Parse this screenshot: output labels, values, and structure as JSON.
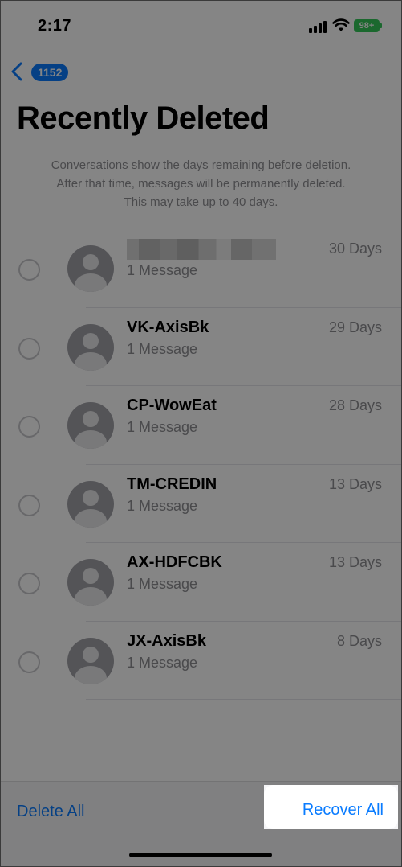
{
  "status_bar": {
    "time": "2:17",
    "battery": "98+",
    "icons": [
      "signal-icon",
      "wifi-icon",
      "battery-icon"
    ]
  },
  "nav": {
    "back_icon": "chevron-left-icon",
    "badge": "1152"
  },
  "title": "Recently Deleted",
  "info_lines": [
    "Conversations show the days remaining before deletion.",
    "After that time, messages will be permanently deleted.",
    "This may take up to 40 days."
  ],
  "conversations": [
    {
      "name": "",
      "name_blurred": true,
      "count": "1 Message",
      "days": "30 Days"
    },
    {
      "name": "VK-AxisBk",
      "count": "1 Message",
      "days": "29 Days"
    },
    {
      "name": "CP-WowEat",
      "count": "1 Message",
      "days": "28 Days"
    },
    {
      "name": "TM-CREDIN",
      "count": "1 Message",
      "days": "13 Days"
    },
    {
      "name": "AX-HDFCBK",
      "count": "1 Message",
      "days": "13 Days"
    },
    {
      "name": "JX-AxisBk",
      "count": "1 Message",
      "days": "8 Days"
    }
  ],
  "toolbar": {
    "delete_all": "Delete All",
    "recover_all": "Recover All"
  },
  "colors": {
    "accent": "#0a7cff",
    "battery": "#34c759",
    "secondary_text": "#8e8e93"
  }
}
